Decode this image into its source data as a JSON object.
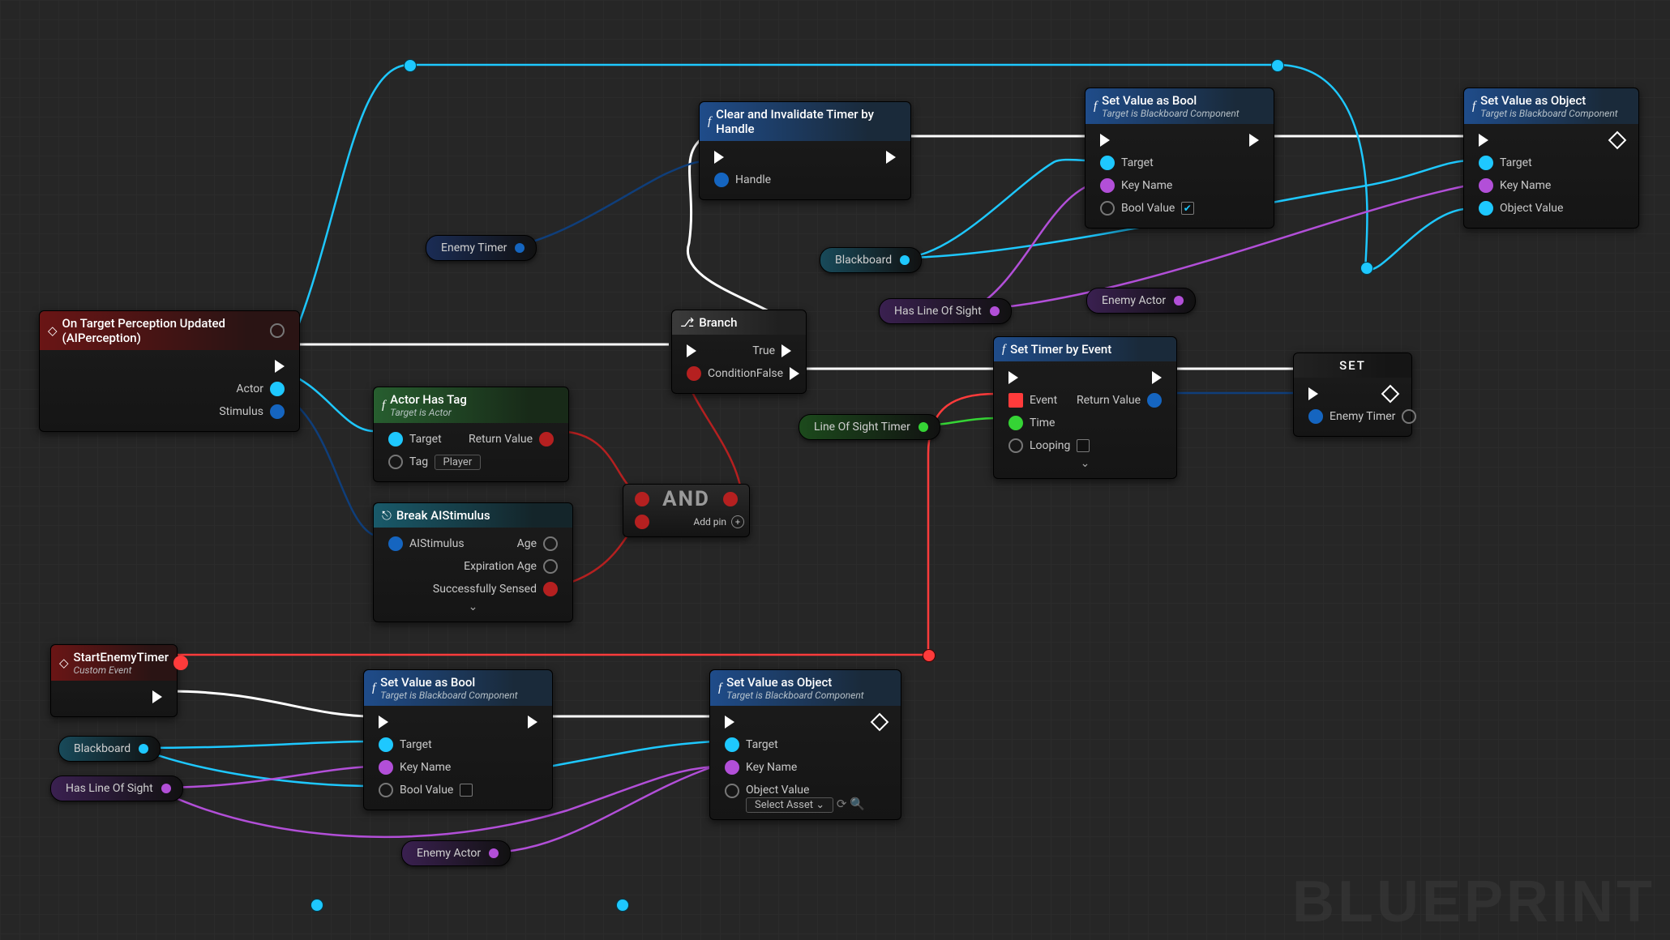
{
  "watermark": "BLUEPRINT",
  "nodes": {
    "perception": {
      "title": "On Target Perception Updated (AIPerception)",
      "actor": "Actor",
      "stimulus": "Stimulus"
    },
    "actorHasTag": {
      "title": "Actor Has Tag",
      "sub": "Target is Actor",
      "target": "Target",
      "tag": "Tag",
      "tagValue": "Player",
      "ret": "Return Value"
    },
    "breakStim": {
      "title": "Break AIStimulus",
      "stim": "AIStimulus",
      "age": "Age",
      "exp": "Expiration Age",
      "sensed": "Successfully Sensed"
    },
    "and": {
      "title": "AND",
      "add": "Add pin"
    },
    "branch": {
      "title": "Branch",
      "cond": "Condition",
      "true": "True",
      "false": "False"
    },
    "clearTimer": {
      "title": "Clear and Invalidate Timer by Handle",
      "handle": "Handle"
    },
    "setBoolTop": {
      "title": "Set Value as Bool",
      "sub": "Target is Blackboard Component",
      "target": "Target",
      "key": "Key Name",
      "bool": "Bool Value"
    },
    "setObjTop": {
      "title": "Set Value as Object",
      "sub": "Target is Blackboard Component",
      "target": "Target",
      "key": "Key Name",
      "obj": "Object Value"
    },
    "setTimer": {
      "title": "Set Timer by Event",
      "event": "Event",
      "time": "Time",
      "loop": "Looping",
      "ret": "Return Value"
    },
    "setNode": {
      "title": "SET",
      "enemyTimer": "Enemy Timer"
    },
    "startEnemy": {
      "title": "StartEnemyTimer",
      "sub": "Custom Event"
    },
    "setBoolBot": {
      "title": "Set Value as Bool",
      "sub": "Target is Blackboard Component",
      "target": "Target",
      "key": "Key Name",
      "bool": "Bool Value"
    },
    "setObjBot": {
      "title": "Set Value as Object",
      "sub": "Target is Blackboard Component",
      "target": "Target",
      "key": "Key Name",
      "obj": "Object Value",
      "sel": "Select Asset"
    }
  },
  "pills": {
    "enemyTimer1": "Enemy Timer",
    "blackboard1": "Blackboard",
    "hasLOS1": "Has Line Of Sight",
    "enemyActor1": "Enemy Actor",
    "losTimer": "Line Of Sight Timer",
    "blackboard2": "Blackboard",
    "hasLOS2": "Has Line Of Sight",
    "enemyActor2": "Enemy Actor"
  }
}
